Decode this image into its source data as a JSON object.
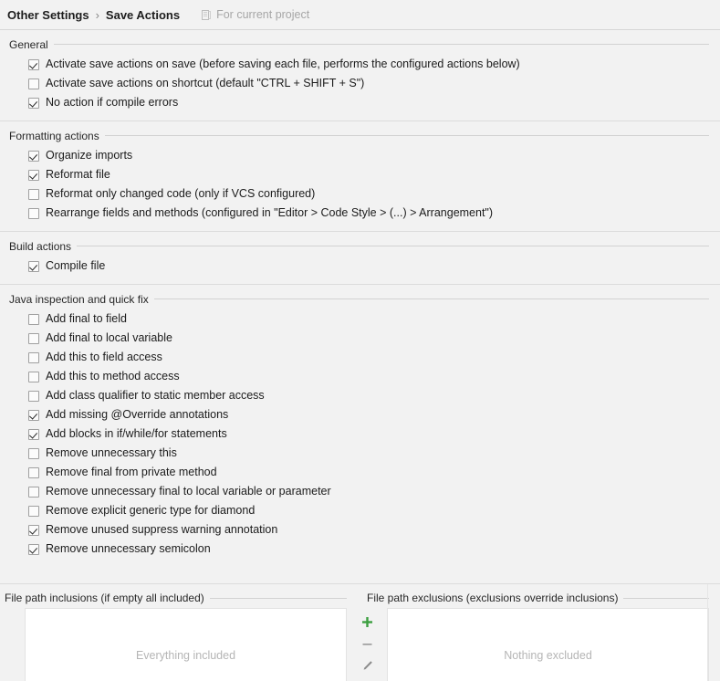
{
  "header": {
    "breadcrumb_parent": "Other Settings",
    "breadcrumb_separator": "›",
    "breadcrumb_current": "Save Actions",
    "scope_icon": "project-file-icon",
    "scope_label": "For current project"
  },
  "sections": [
    {
      "id": "general",
      "title": "General",
      "options": [
        {
          "label": "Activate save actions on save (before saving each file, performs the configured actions below)",
          "checked": true
        },
        {
          "label": "Activate save actions on shortcut (default \"CTRL + SHIFT + S\")",
          "checked": false
        },
        {
          "label": "No action if compile errors",
          "checked": true
        }
      ]
    },
    {
      "id": "formatting-actions",
      "title": "Formatting actions",
      "options": [
        {
          "label": "Organize imports",
          "checked": true
        },
        {
          "label": "Reformat file",
          "checked": true
        },
        {
          "label": "Reformat only changed code (only if VCS configured)",
          "checked": false
        },
        {
          "label": "Rearrange fields and methods (configured in \"Editor > Code Style > (...) > Arrangement\")",
          "checked": false
        }
      ]
    },
    {
      "id": "build-actions",
      "title": "Build actions",
      "options": [
        {
          "label": "Compile file",
          "checked": true
        }
      ]
    },
    {
      "id": "java-inspection-and-quick-fix",
      "title": "Java inspection and quick fix",
      "options": [
        {
          "label": "Add final to field",
          "checked": false
        },
        {
          "label": "Add final to local variable",
          "checked": false
        },
        {
          "label": "Add this to field access",
          "checked": false
        },
        {
          "label": "Add this to method access",
          "checked": false
        },
        {
          "label": "Add class qualifier to static member access",
          "checked": false
        },
        {
          "label": "Add missing @Override annotations",
          "checked": true
        },
        {
          "label": "Add blocks in if/while/for statements",
          "checked": true
        },
        {
          "label": "Remove unnecessary this",
          "checked": false
        },
        {
          "label": "Remove final from private method",
          "checked": false
        },
        {
          "label": "Remove unnecessary final to local variable or parameter",
          "checked": false
        },
        {
          "label": "Remove explicit generic type for diamond",
          "checked": false
        },
        {
          "label": "Remove unused suppress warning annotation",
          "checked": true
        },
        {
          "label": "Remove unnecessary semicolon",
          "checked": true
        }
      ]
    }
  ],
  "paths": {
    "inclusions_title": "File path inclusions (if empty all included)",
    "exclusions_title": "File path exclusions (exclusions override inclusions)",
    "inclusions_empty": "Everything included",
    "exclusions_empty": "Nothing excluded",
    "toolbar": [
      {
        "name": "add-icon",
        "glyph": "+",
        "color": "#3c9f40"
      },
      {
        "name": "remove-icon",
        "glyph": "−",
        "color": "#9a9a9a"
      },
      {
        "name": "edit-icon",
        "glyph": "pencil",
        "color": "#8c8c8c"
      }
    ]
  }
}
